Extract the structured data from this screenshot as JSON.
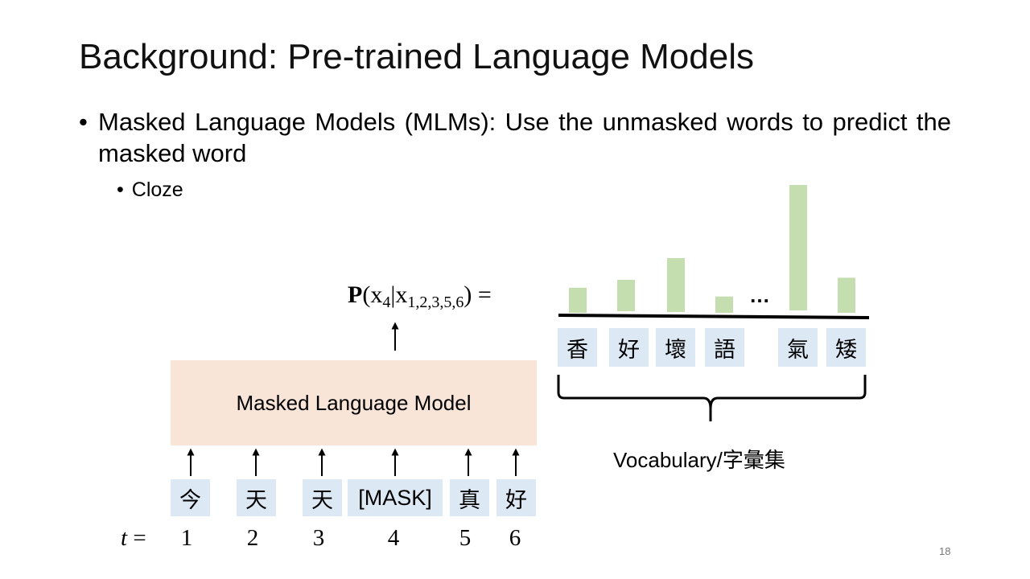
{
  "slide": {
    "title": "Background: Pre-trained Language Models",
    "bullet_main": "Masked Language Models (MLMs): Use the unmasked words to predict the masked word",
    "bullet_sub": "Cloze",
    "page_number": "18"
  },
  "diagram": {
    "model_label": "Masked Language Model",
    "tokens": [
      "今",
      "天",
      "天",
      "[MASK]",
      "真",
      "好"
    ],
    "t_var": "t",
    "t_equals": " = ",
    "positions": [
      "1",
      "2",
      "3",
      "4",
      "5",
      "6"
    ],
    "formula": {
      "P": "P",
      "open": "(x",
      "sub1": "4",
      "bar": "|x",
      "sub2": "1,2,3,5,6",
      "close": ") ="
    },
    "vocabulary": [
      "香",
      "好",
      "壞",
      "語",
      "氣",
      "矮"
    ],
    "ellipsis": "…",
    "vocab_label": "Vocabulary/字彙集",
    "bar_color": "#c5deb0",
    "box_color": "#f8e5d7",
    "token_color": "#dde8f5",
    "probability_bars": [
      {
        "word": "香",
        "value": 0.2
      },
      {
        "word": "好",
        "value": 0.25
      },
      {
        "word": "壞",
        "value": 0.43
      },
      {
        "word": "語",
        "value": 0.13
      },
      {
        "word": "氣",
        "value": 1.0
      },
      {
        "word": "矮",
        "value": 0.28
      }
    ]
  }
}
